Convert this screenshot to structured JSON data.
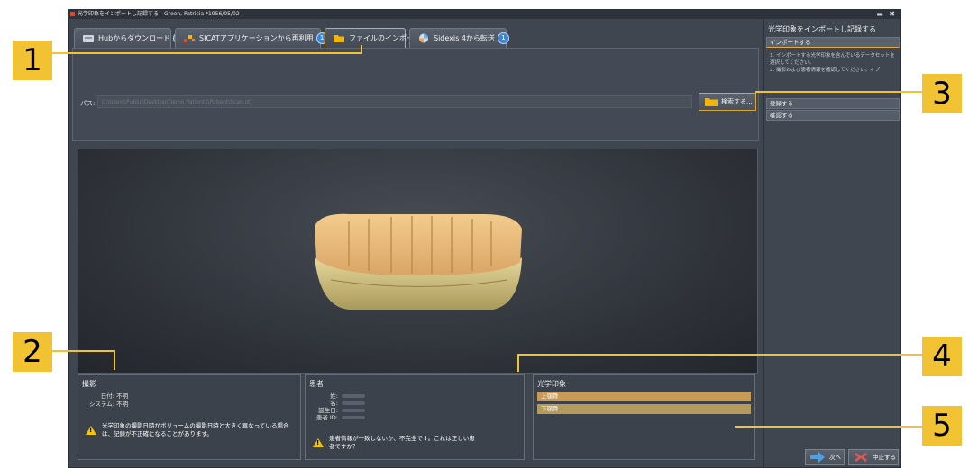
{
  "window": {
    "title": "光学印象をインポートし記録する - Green, Patricia *1956/05/02"
  },
  "tabs": [
    {
      "label": "Hubからダウンロード",
      "badge": "2"
    },
    {
      "label": "SICATアプリケーションから再利用",
      "badge": "1"
    },
    {
      "label": "ファイルのインポート",
      "badge": ""
    },
    {
      "label": "Sidexis 4から転送",
      "badge": "1"
    }
  ],
  "import": {
    "path_label": "パス:",
    "path_value": "C:\\Users\\Public\\Desktop\\Demo Patients\\Patient\\Scan.stl",
    "browse_label": "検索する..."
  },
  "recording": {
    "title": "撮影",
    "date_label": "日付:",
    "date_value": "不明",
    "system_label": "システム:",
    "system_value": "不明",
    "warning": "光学印象の撮影日時がボリュームの撮影日時と大きく異なっている場合は、記録が不正確になることがあります。"
  },
  "patient": {
    "title": "患者",
    "last_name_label": "姓:",
    "first_name_label": "名:",
    "birth_label": "誕生日:",
    "id_label": "患者 ID:",
    "warning": "患者情報が一致しないか、不完全です。これは正しい患者ですか？"
  },
  "optical": {
    "title": "光学印象",
    "upper": "上顎骨",
    "lower": "下顎骨"
  },
  "sidebar": {
    "title": "光学印象をインポートし記録する",
    "steps": [
      "インポートする",
      "登録する",
      "確認する"
    ],
    "instructions": "1. インポートする光学印象を含んでいるデータセットを選択してください。\n2. 撮影および患者情報を確認してください。オプ"
  },
  "footer": {
    "next": "次へ",
    "cancel": "中止する"
  },
  "callouts": [
    "1",
    "2",
    "3",
    "4",
    "5"
  ],
  "colors": {
    "accent": "#f1c232",
    "active_tab_border": "#e1aa3e",
    "badge": "#3b86d6",
    "warning": "#f2c600"
  }
}
